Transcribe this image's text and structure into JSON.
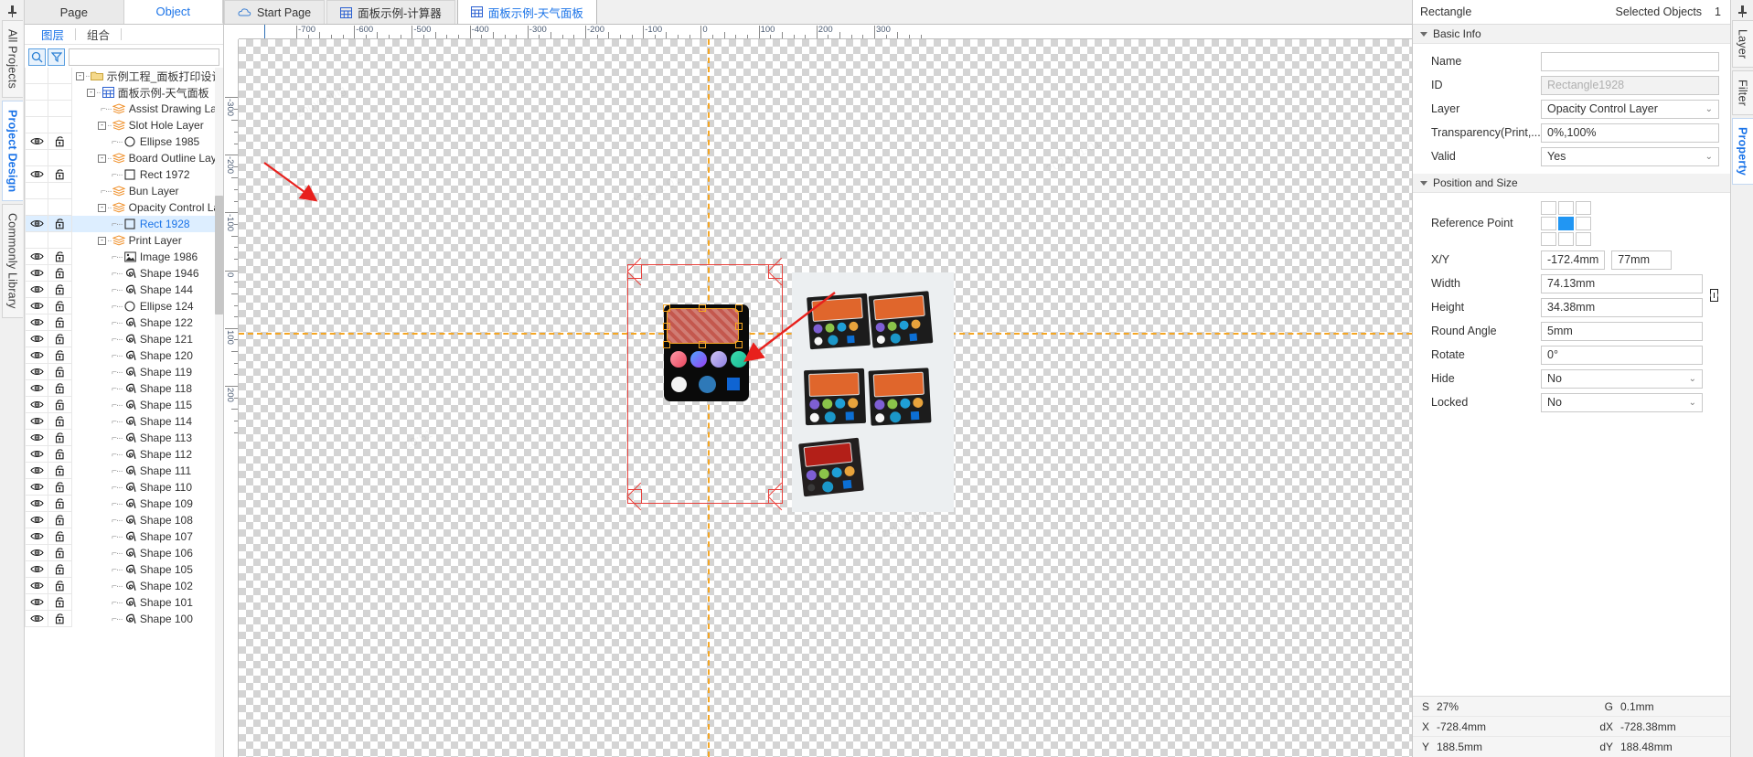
{
  "left_rail": {
    "pin_icon": "pin-icon",
    "tabs": [
      {
        "label": "All Projects",
        "active": false
      },
      {
        "label": "Project Design",
        "active": true
      },
      {
        "label": "Commonly Library",
        "active": false
      }
    ]
  },
  "left_panel": {
    "top_tabs": [
      {
        "label": "Page",
        "active": false
      },
      {
        "label": "Object",
        "active": true
      }
    ],
    "sub_tabs": [
      {
        "label": "图层",
        "active": true
      },
      {
        "label": "组合",
        "active": false
      }
    ],
    "search": {
      "search_icon": "search-icon",
      "filter_icon": "filter-icon",
      "placeholder": "",
      "value": ""
    },
    "tree": [
      {
        "label": "示例工程_面板打印设计",
        "icon": "folder-icon",
        "depth": 0,
        "expander": "-",
        "eye": false,
        "lock": false,
        "selected": false
      },
      {
        "label": "面板示例-天气面板",
        "icon": "page-icon",
        "depth": 1,
        "expander": "-",
        "eye": false,
        "lock": false,
        "selected": false
      },
      {
        "label": "Assist Drawing Layer",
        "icon": "layers-icon",
        "depth": 2,
        "expander": "",
        "eye": false,
        "lock": false,
        "selected": false
      },
      {
        "label": "Slot Hole Layer",
        "icon": "layers-icon",
        "depth": 2,
        "expander": "-",
        "eye": false,
        "lock": false,
        "selected": false
      },
      {
        "label": "Ellipse 1985",
        "icon": "circle-icon",
        "depth": 3,
        "expander": "",
        "eye": true,
        "lock": true,
        "selected": false
      },
      {
        "label": "Board Outline Layer",
        "icon": "layers-icon",
        "depth": 2,
        "expander": "-",
        "eye": false,
        "lock": false,
        "selected": false
      },
      {
        "label": "Rect 1972",
        "icon": "square-icon",
        "depth": 3,
        "expander": "",
        "eye": true,
        "lock": true,
        "selected": false
      },
      {
        "label": "Bun Layer",
        "icon": "layers-icon",
        "depth": 2,
        "expander": "",
        "eye": false,
        "lock": false,
        "selected": false
      },
      {
        "label": "Opacity Control Layer",
        "icon": "layers-icon",
        "depth": 2,
        "expander": "-",
        "eye": false,
        "lock": false,
        "selected": false
      },
      {
        "label": "Rect 1928",
        "icon": "square-icon",
        "depth": 3,
        "expander": "",
        "eye": true,
        "lock": true,
        "selected": true
      },
      {
        "label": "Print Layer",
        "icon": "layers-icon",
        "depth": 2,
        "expander": "-",
        "eye": false,
        "lock": false,
        "selected": false
      },
      {
        "label": "Image 1986",
        "icon": "image-icon",
        "depth": 3,
        "expander": "",
        "eye": true,
        "lock": true,
        "selected": false
      },
      {
        "label": "Shape 1946",
        "icon": "shape-icon",
        "depth": 3,
        "expander": "",
        "eye": true,
        "lock": true,
        "selected": false
      },
      {
        "label": "Shape 144",
        "icon": "shape-icon",
        "depth": 3,
        "expander": "",
        "eye": true,
        "lock": true,
        "selected": false
      },
      {
        "label": "Ellipse 124",
        "icon": "circle-icon",
        "depth": 3,
        "expander": "",
        "eye": true,
        "lock": true,
        "selected": false
      },
      {
        "label": "Shape 122",
        "icon": "shape-icon",
        "depth": 3,
        "expander": "",
        "eye": true,
        "lock": true,
        "selected": false
      },
      {
        "label": "Shape 121",
        "icon": "shape-icon",
        "depth": 3,
        "expander": "",
        "eye": true,
        "lock": true,
        "selected": false
      },
      {
        "label": "Shape 120",
        "icon": "shape-icon",
        "depth": 3,
        "expander": "",
        "eye": true,
        "lock": true,
        "selected": false
      },
      {
        "label": "Shape 119",
        "icon": "shape-icon",
        "depth": 3,
        "expander": "",
        "eye": true,
        "lock": true,
        "selected": false
      },
      {
        "label": "Shape 118",
        "icon": "shape-icon",
        "depth": 3,
        "expander": "",
        "eye": true,
        "lock": true,
        "selected": false
      },
      {
        "label": "Shape 115",
        "icon": "shape-icon",
        "depth": 3,
        "expander": "",
        "eye": true,
        "lock": true,
        "selected": false
      },
      {
        "label": "Shape 114",
        "icon": "shape-icon",
        "depth": 3,
        "expander": "",
        "eye": true,
        "lock": true,
        "selected": false
      },
      {
        "label": "Shape 113",
        "icon": "shape-icon",
        "depth": 3,
        "expander": "",
        "eye": true,
        "lock": true,
        "selected": false
      },
      {
        "label": "Shape 112",
        "icon": "shape-icon",
        "depth": 3,
        "expander": "",
        "eye": true,
        "lock": true,
        "selected": false
      },
      {
        "label": "Shape 111",
        "icon": "shape-icon",
        "depth": 3,
        "expander": "",
        "eye": true,
        "lock": true,
        "selected": false
      },
      {
        "label": "Shape 110",
        "icon": "shape-icon",
        "depth": 3,
        "expander": "",
        "eye": true,
        "lock": true,
        "selected": false
      },
      {
        "label": "Shape 109",
        "icon": "shape-icon",
        "depth": 3,
        "expander": "",
        "eye": true,
        "lock": true,
        "selected": false
      },
      {
        "label": "Shape 108",
        "icon": "shape-icon",
        "depth": 3,
        "expander": "",
        "eye": true,
        "lock": true,
        "selected": false
      },
      {
        "label": "Shape 107",
        "icon": "shape-icon",
        "depth": 3,
        "expander": "",
        "eye": true,
        "lock": true,
        "selected": false
      },
      {
        "label": "Shape 106",
        "icon": "shape-icon",
        "depth": 3,
        "expander": "",
        "eye": true,
        "lock": true,
        "selected": false
      },
      {
        "label": "Shape 105",
        "icon": "shape-icon",
        "depth": 3,
        "expander": "",
        "eye": true,
        "lock": true,
        "selected": false
      },
      {
        "label": "Shape 102",
        "icon": "shape-icon",
        "depth": 3,
        "expander": "",
        "eye": true,
        "lock": true,
        "selected": false
      },
      {
        "label": "Shape 101",
        "icon": "shape-icon",
        "depth": 3,
        "expander": "",
        "eye": true,
        "lock": true,
        "selected": false
      },
      {
        "label": "Shape 100",
        "icon": "shape-icon",
        "depth": 3,
        "expander": "",
        "eye": true,
        "lock": true,
        "selected": false
      }
    ]
  },
  "document_tabs": [
    {
      "label": "Start Page",
      "icon": "cloud-icon",
      "active": false
    },
    {
      "label": "面板示例-计算器",
      "icon": "board-icon",
      "active": false
    },
    {
      "label": "面板示例-天气面板",
      "icon": "board-icon",
      "active": true
    }
  ],
  "rulers": {
    "horizontal_labels": [
      "-700",
      "-600",
      "-500",
      "-400",
      "-300",
      "-200",
      "-100",
      "0",
      "100",
      "200",
      "300"
    ],
    "vertical_labels": [
      "-300",
      "-200",
      "-100",
      "0",
      "100",
      "200"
    ],
    "unit": "mm"
  },
  "right_panel": {
    "object_type": "Rectangle",
    "selected_objects_label": "Selected Objects",
    "selected_objects_count": "1",
    "sections": [
      {
        "title": "Basic Info",
        "rows": [
          {
            "label": "Name",
            "value": "",
            "type": "text",
            "disabled": false
          },
          {
            "label": "ID",
            "value": "Rectangle1928",
            "type": "text",
            "disabled": true
          },
          {
            "label": "Layer",
            "value": "Opacity Control Layer",
            "type": "select",
            "disabled": false
          },
          {
            "label": "Transparency(Print,...",
            "value": "0%,100%",
            "type": "text",
            "disabled": false
          },
          {
            "label": "Valid",
            "value": "Yes",
            "type": "select",
            "disabled": false
          }
        ]
      },
      {
        "title": "Position and Size",
        "rows": [
          {
            "label": "Reference Point",
            "value": "",
            "type": "refgrid",
            "disabled": false
          },
          {
            "label": "X/Y",
            "value": "-172.4mm",
            "value2": "77mm",
            "type": "pair",
            "disabled": false
          },
          {
            "label": "Width",
            "value": "74.13mm",
            "type": "text",
            "disabled": false
          },
          {
            "label": "Height",
            "value": "34.38mm",
            "type": "text",
            "disabled": false
          },
          {
            "label": "Round Angle",
            "value": "5mm",
            "type": "text",
            "disabled": false
          },
          {
            "label": "Rotate",
            "value": "0°",
            "type": "text",
            "disabled": false
          },
          {
            "label": "Hide",
            "value": "No",
            "type": "select",
            "disabled": false
          },
          {
            "label": "Locked",
            "value": "No",
            "type": "select",
            "disabled": false
          }
        ]
      }
    ],
    "status": [
      {
        "key": "S",
        "value": "27%",
        "key2": "G",
        "value2": "0.1mm"
      },
      {
        "key": "X",
        "value": "-728.4mm",
        "key2": "dX",
        "value2": "-728.38mm"
      },
      {
        "key": "Y",
        "value": "188.5mm",
        "key2": "dY",
        "value2": "188.48mm"
      }
    ]
  },
  "right_rail": {
    "pin_icon": "pin-icon",
    "tabs": [
      {
        "label": "Layer",
        "active": false
      },
      {
        "label": "Filter",
        "active": false
      },
      {
        "label": "Property",
        "active": true
      }
    ]
  },
  "colors": {
    "accent": "#1a73e8",
    "guide": "#f5a623",
    "outline": "#e8413c",
    "selection_fill": "#de6357",
    "reference_on": "#2196f3"
  },
  "canvas": {
    "selection_rect_label": "rect-1928-selection",
    "annotation_arrows": 2,
    "device_preview_label": "weather-panel-preview",
    "photo_label": "panel-photo"
  }
}
